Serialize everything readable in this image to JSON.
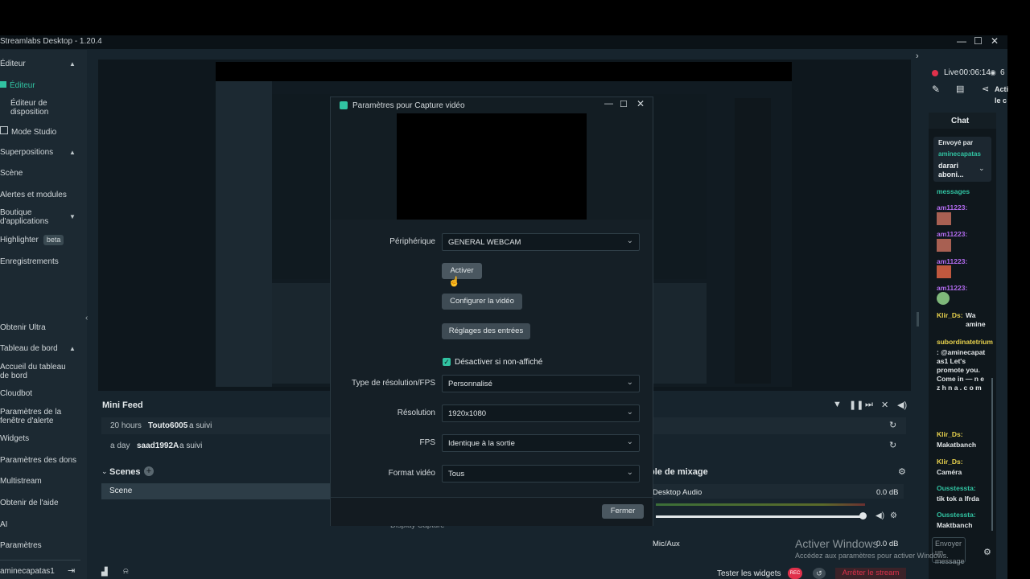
{
  "app": {
    "title": "Streamlabs Desktop - 1.20.4",
    "window_controls": {
      "minimize": "—",
      "maximize": "☐",
      "close": "✕"
    }
  },
  "sidebar": {
    "items": [
      {
        "label": "Éditeur",
        "caret": "▲"
      },
      {
        "label": "Éditeur"
      },
      {
        "label": "Éditeur de disposition"
      },
      {
        "label": "Mode Studio"
      },
      {
        "label": "Superpositions",
        "caret": "▲"
      },
      {
        "label": "Scène"
      },
      {
        "label": "Alertes et modules"
      },
      {
        "label": "Boutique d'applications",
        "caret": "▼"
      },
      {
        "label": "Highlighter",
        "badge": "beta"
      },
      {
        "label": "Enregistrements"
      },
      {
        "label": "Obtenir Ultra"
      },
      {
        "label": "Tableau de bord",
        "caret": "▲"
      },
      {
        "label": "Accueil du tableau de bord"
      },
      {
        "label": "Cloudbot"
      },
      {
        "label": "Paramètres de la fenêtre d'alerte"
      },
      {
        "label": "Widgets"
      },
      {
        "label": "Paramètres des dons"
      },
      {
        "label": "Multistream"
      },
      {
        "label": "Obtenir de l'aide"
      },
      {
        "label": "AI"
      },
      {
        "label": "Paramètres"
      },
      {
        "label": "aminecapatas1"
      }
    ]
  },
  "live": {
    "label": "Live",
    "time": "00:06:14",
    "viewers": "6",
    "action": "Acti",
    "action2": "le c"
  },
  "minifeed": {
    "title": "Mini Feed",
    "rows": [
      {
        "time": "20 hours",
        "user": "Touto6005",
        "action": "a suivi"
      },
      {
        "time": "a day",
        "user": "saad1992A",
        "action": "a suivi"
      }
    ]
  },
  "scenes": {
    "title": "Scenes",
    "items": [
      "Scene"
    ]
  },
  "sources": {
    "item": "Display Capture"
  },
  "mixer": {
    "title": "ble de mixage",
    "channels": [
      {
        "name": "Desktop Audio",
        "db": "0.0 dB"
      },
      {
        "name": "Mic/Aux",
        "db": "0.0 dB"
      }
    ]
  },
  "footer": {
    "test_widgets": "Tester les widgets",
    "rec": "REC",
    "stop_stream": "Arrêter le stream"
  },
  "dialog": {
    "title": "Paramètres pour Capture vidéo",
    "device_label": "Périphérique",
    "device_value": "GENERAL WEBCAM",
    "activate": "Activer",
    "configure_video": "Configurer la vidéo",
    "input_settings": "Réglages des entrées",
    "disable_hidden": "Désactiver si non-affiché",
    "resolution_type_label": "Type de résolution/FPS",
    "resolution_type_value": "Personnalisé",
    "resolution_label": "Résolution",
    "resolution_value": "1920x1080",
    "fps_label": "FPS",
    "fps_value": "Identique à la sortie",
    "format_label": "Format vidéo",
    "format_value": "Tous",
    "close": "Fermer"
  },
  "chat": {
    "title": "Chat",
    "pinned_by": "Envoyé par",
    "pinned_user": "aminecapatas",
    "pinned_text": "darari aboni...",
    "messages_label": "messages",
    "entries": [
      {
        "user": "am11223:",
        "text": ""
      },
      {
        "user": "am11223:",
        "text": ""
      },
      {
        "user": "am11223:",
        "text": ""
      },
      {
        "user": "am11223:",
        "text": ""
      },
      {
        "user": "Klir_Ds:",
        "text": "Wa amine"
      },
      {
        "user": "subordinatetrium",
        "text": ": @aminecapat as1 Let's promote you. Come in — n e z h n a . c o m"
      },
      {
        "user": "Klir_Ds:",
        "text": "Makatbanch"
      },
      {
        "user": "Klir_Ds:",
        "text": "Caméra"
      },
      {
        "user": "Ousstessta:",
        "text": "tik tok a lfrda"
      },
      {
        "user": "Ousstessta:",
        "text": "Maktbanch"
      }
    ],
    "send": "Envoyer un message"
  },
  "watermark": {
    "title": "Activer Windows",
    "subtitle": "Accédez aux paramètres pour activer Windows."
  },
  "colors": {
    "accent": "#31c3a2",
    "danger": "#e0314b",
    "chat_purple": "#b36cf0",
    "chat_yellow": "#e9d24d",
    "chat_teal": "#31c3a2"
  }
}
